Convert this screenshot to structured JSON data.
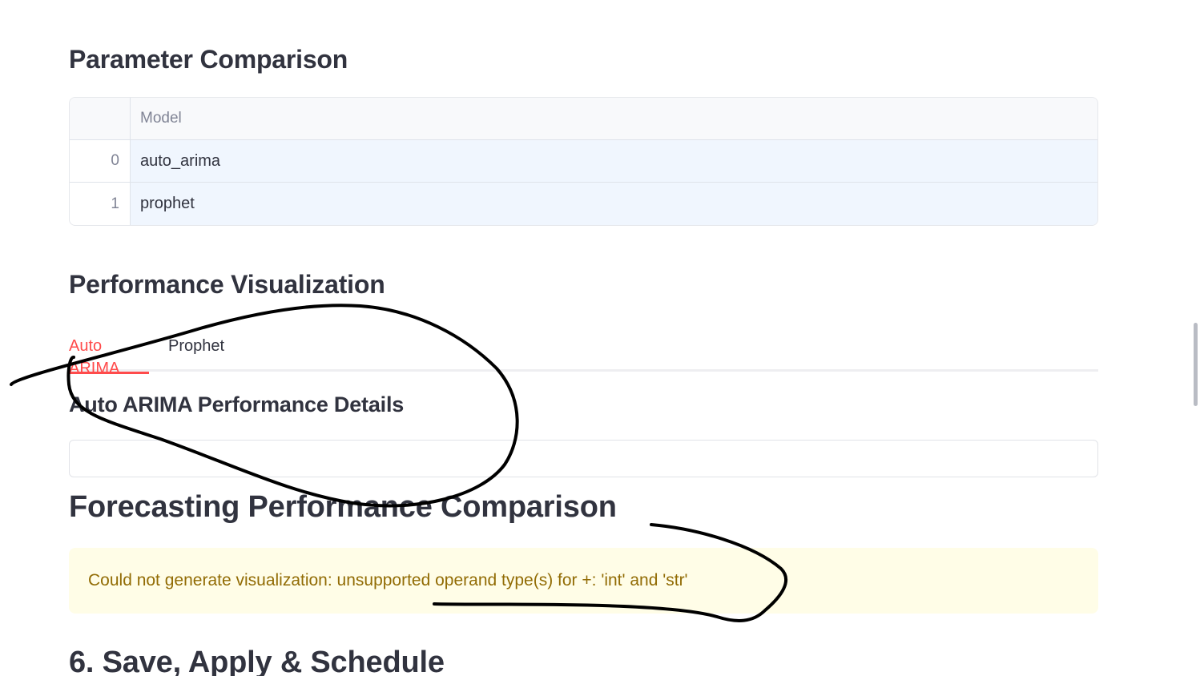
{
  "sections": {
    "parameter_comparison": "Parameter Comparison",
    "performance_visualization": "Performance Visualization",
    "details_heading": "Auto ARIMA Performance Details",
    "forecasting_comparison": "Forecasting Performance Comparison",
    "save_apply_schedule": "6. Save, Apply & Schedule"
  },
  "table": {
    "column_header": "Model",
    "rows": [
      {
        "index": "0",
        "model": "auto_arima"
      },
      {
        "index": "1",
        "model": "prophet"
      }
    ]
  },
  "tabs": [
    {
      "label": "Auto ARIMA",
      "active": true
    },
    {
      "label": "Prophet",
      "active": false
    }
  ],
  "alert": {
    "message": "Could not generate visualization: unsupported operand type(s) for +: 'int' and 'str'"
  },
  "colors": {
    "accent": "#ff4b4b",
    "warning_text": "#926c05",
    "warning_bg": "#fffde7",
    "ink": "#000000"
  }
}
